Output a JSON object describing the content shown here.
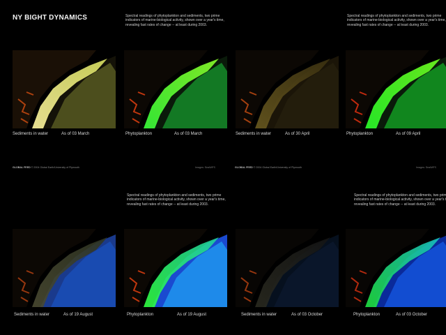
{
  "title": "NY BIGHT DYNAMICS",
  "description": "Spectral readings of phytoplankton and sediments, two prime indicators of marine-biological activity, shown over a year's time, revealing fast rates of change -- at least during 2003.",
  "footer": {
    "brand": "GLOBAL FEED",
    "copyright": "© 2004 Global Earth/University of Plymouth",
    "image_credit": "Images: SeaWiFS"
  },
  "panels": [
    {
      "label": "Sediments in water",
      "date": "As of 03 March",
      "palette": "sediment-bright"
    },
    {
      "label": "Phytoplankton",
      "date": "As of 03 March",
      "palette": "phyto-green"
    },
    {
      "label": "Sediments in water",
      "date": "As of 30 April",
      "palette": "sediment-dark"
    },
    {
      "label": "Phytoplankton",
      "date": "As of 09 April",
      "palette": "phyto-bright"
    },
    {
      "label": "Sediments in water",
      "date": "As of 19 August",
      "palette": "sediment-blue"
    },
    {
      "label": "Phytoplankton",
      "date": "As of 19 August",
      "palette": "phyto-mixed"
    },
    {
      "label": "Sediments in water",
      "date": "As of 03 October",
      "palette": "sediment-night"
    },
    {
      "label": "Phytoplankton",
      "date": "As of 03 October",
      "palette": "phyto-blue"
    }
  ]
}
